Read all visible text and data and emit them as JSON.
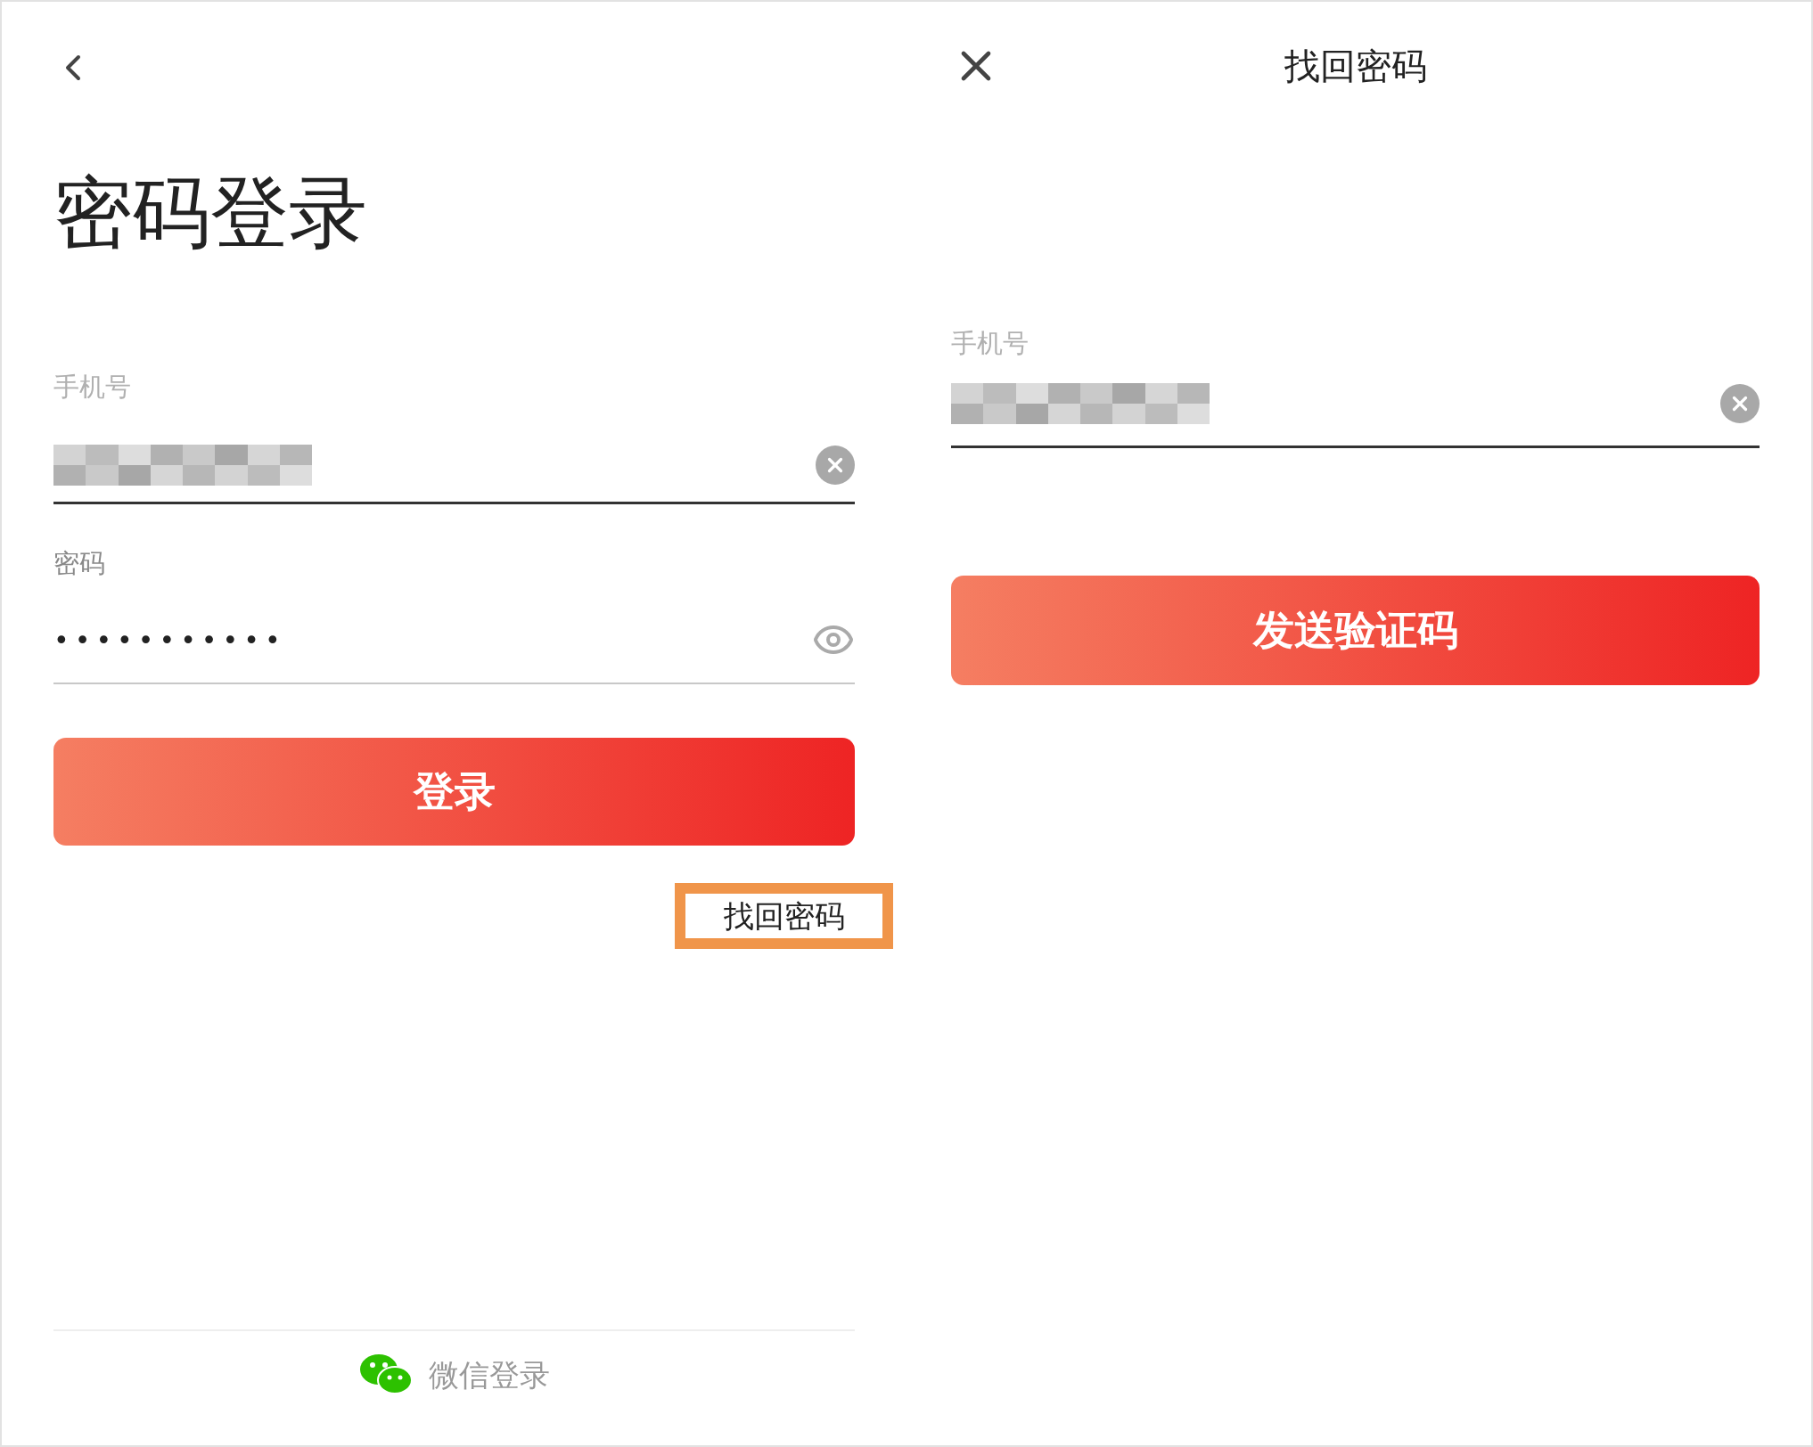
{
  "login_screen": {
    "title": "密码登录",
    "phone_field": {
      "label": "手机号",
      "redacted": true
    },
    "password_field": {
      "label": "密码",
      "value": "•••••••••••",
      "masked": true
    },
    "login_button": "登录",
    "forgot_link": {
      "label": "找回密码",
      "highlighted": true
    },
    "wechat_login": "微信登录"
  },
  "recover_screen": {
    "title": "找回密码",
    "phone_field": {
      "label": "手机号",
      "redacted": true
    },
    "send_button": "发送验证码"
  }
}
